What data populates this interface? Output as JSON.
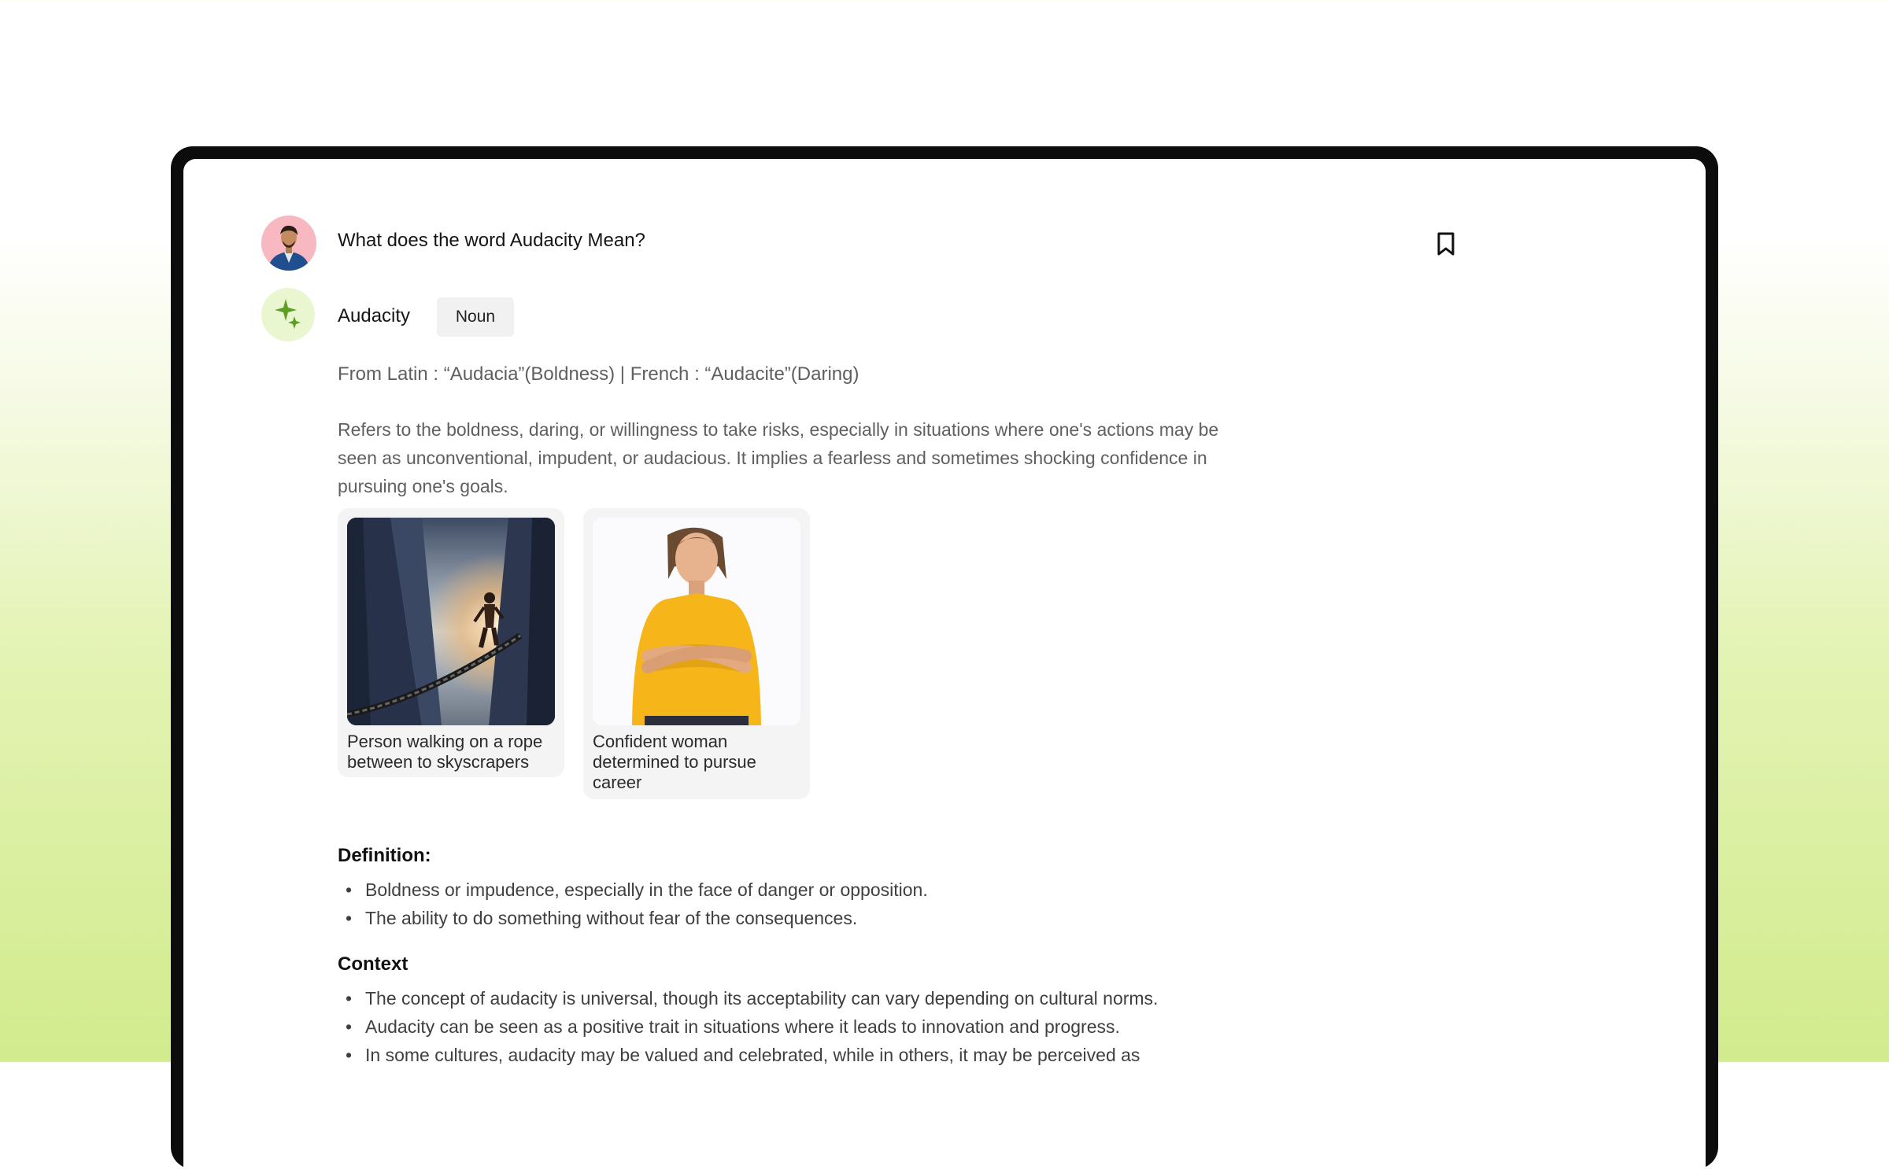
{
  "conversation": {
    "question": "What does the word Audacity Mean?",
    "word": "Audacity",
    "part_of_speech": "Noun",
    "etymology": "From Latin : “Audacia”(Boldness) | French : “Audacite”(Daring)",
    "description": "Refers to the boldness, daring, or willingness to take risks, especially in situations where one's actions may be seen as unconventional, impudent, or audacious. It implies a fearless and sometimes shocking confidence in pursuing one's goals."
  },
  "images": [
    {
      "caption": "Person walking on a rope between to skyscrapers",
      "icon": "rope-walker-photo"
    },
    {
      "caption": "Confident woman determined to pursue career",
      "icon": "confident-woman-photo"
    }
  ],
  "definition": {
    "title": "Definition:",
    "items": [
      "Boldness or impudence, especially in the face of danger or opposition.",
      "The ability to do something without fear of the consequences."
    ]
  },
  "context": {
    "title": "Context",
    "items": [
      "The concept of audacity is universal, though its acceptability can vary depending on cultural norms.",
      "Audacity can be seen as a positive trait in situations where it leads to innovation and progress.",
      "In some cultures, audacity may be valued and celebrated, while in others, it may be perceived as"
    ]
  },
  "icons": {
    "bookmark": "bookmark-icon",
    "ai": "sparkle-icon",
    "user": "user-avatar"
  },
  "colors": {
    "accent_green": "#5f9e25",
    "ai_avatar_bg": "#e9f6cf",
    "user_avatar_bg": "#f7b8c2",
    "frame": "#0c0c0c"
  }
}
